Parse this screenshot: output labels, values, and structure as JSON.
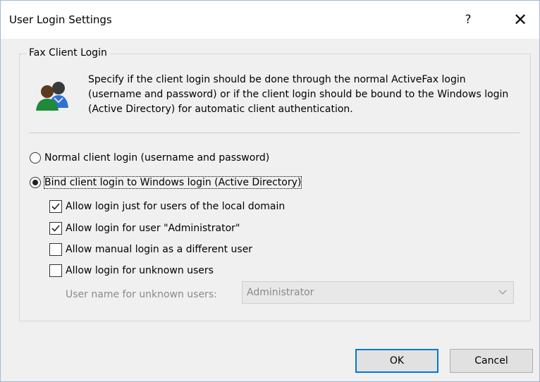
{
  "window": {
    "title": "User Login Settings",
    "help_glyph": "?",
    "close_glyph": "✕"
  },
  "group": {
    "legend": "Fax Client Login",
    "description": "Specify if the client login should be done through the normal ActiveFax login (username and password) or if the client login should be bound to the Windows login (Active Directory) for automatic client authentication."
  },
  "radios": [
    {
      "label": "Normal client login (username and password)",
      "checked": false
    },
    {
      "label": "Bind client login to Windows login (Active Directory)",
      "checked": true
    }
  ],
  "checkboxes": [
    {
      "label": "Allow login just for users of the local domain",
      "checked": true
    },
    {
      "label": "Allow login for user \"Administrator\"",
      "checked": true
    },
    {
      "label": "Allow manual login as a different user",
      "checked": false
    },
    {
      "label": "Allow login for unknown users",
      "checked": false
    }
  ],
  "unknown_user": {
    "label": "User name for unknown users:",
    "value": "Administrator"
  },
  "buttons": {
    "ok": "OK",
    "cancel": "Cancel"
  },
  "colors": {
    "accent": "#0078d7",
    "dialog_bg": "#f0f0f0"
  },
  "icons": [
    "users-icon",
    "help-icon",
    "close-icon",
    "chevron-down-icon",
    "checkmark-icon"
  ]
}
